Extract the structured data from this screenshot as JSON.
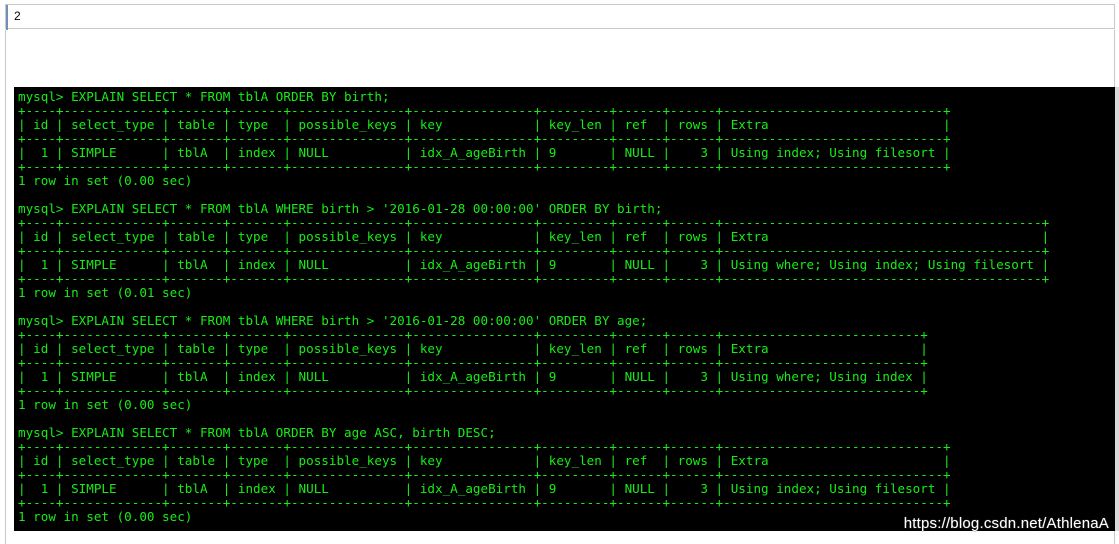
{
  "top_field": {
    "value": "2"
  },
  "terminal": {
    "lines": [
      "mysql> EXPLAIN SELECT * FROM tblA ORDER BY birth;",
      "+----+-------------+-------+-------+---------------+----------------+---------+------+------+-----------------------------+",
      "| id | select_type | table | type  | possible_keys | key            | key_len | ref  | rows | Extra                       |",
      "+----+-------------+-------+-------+---------------+----------------+---------+------+------+-----------------------------+",
      "|  1 | SIMPLE      | tblA  | index | NULL          | idx_A_ageBirth | 9       | NULL |    3 | Using index; Using filesort |",
      "+----+-------------+-------+-------+---------------+----------------+---------+------+------+-----------------------------+",
      "1 row in set (0.00 sec)",
      "",
      "mysql> EXPLAIN SELECT * FROM tblA WHERE birth > '2016-01-28 00:00:00' ORDER BY birth;",
      "+----+-------------+-------+-------+---------------+----------------+---------+------+------+------------------------------------------+",
      "| id | select_type | table | type  | possible_keys | key            | key_len | ref  | rows | Extra                                    |",
      "+----+-------------+-------+-------+---------------+----------------+---------+------+------+------------------------------------------+",
      "|  1 | SIMPLE      | tblA  | index | NULL          | idx_A_ageBirth | 9       | NULL |    3 | Using where; Using index; Using filesort |",
      "+----+-------------+-------+-------+---------------+----------------+---------+------+------+------------------------------------------+",
      "1 row in set (0.01 sec)",
      "",
      "mysql> EXPLAIN SELECT * FROM tblA WHERE birth > '2016-01-28 00:00:00' ORDER BY age;",
      "+----+-------------+-------+-------+---------------+----------------+---------+------+------+--------------------------+",
      "| id | select_type | table | type  | possible_keys | key            | key_len | ref  | rows | Extra                    |",
      "+----+-------------+-------+-------+---------------+----------------+---------+------+------+--------------------------+",
      "|  1 | SIMPLE      | tblA  | index | NULL          | idx_A_ageBirth | 9       | NULL |    3 | Using where; Using index |",
      "+----+-------------+-------+-------+---------------+----------------+---------+------+------+--------------------------+",
      "1 row in set (0.00 sec)",
      "",
      "mysql> EXPLAIN SELECT * FROM tblA ORDER BY age ASC, birth DESC;",
      "+----+-------------+-------+-------+---------------+----------------+---------+------+------+-----------------------------+",
      "| id | select_type | table | type  | possible_keys | key            | key_len | ref  | rows | Extra                       |",
      "+----+-------------+-------+-------+---------------+----------------+---------+------+------+-----------------------------+",
      "|  1 | SIMPLE      | tblA  | index | NULL          | idx_A_ageBirth | 9       | NULL |    3 | Using index; Using filesort |",
      "+----+-------------+-------+-------+---------------+----------------+---------+------+------+-----------------------------+",
      "1 row in set (0.00 sec)"
    ]
  },
  "watermark": {
    "text": "https://blog.csdn.net/AthlenaA"
  },
  "colors": {
    "terminal_bg": "#000000",
    "terminal_text": "#17ec17",
    "page_bg": "#ffffff"
  }
}
